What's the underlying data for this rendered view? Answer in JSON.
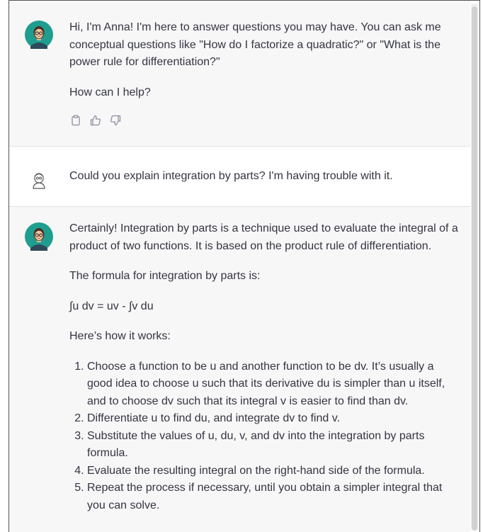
{
  "messages": [
    {
      "role": "assistant",
      "paragraphs": [
        "Hi, I'm Anna! I'm here to answer questions you may have. You can ask me conceptual questions like \"How do I factorize a quadratic?\" or \"What is the power rule for differentiation?\"",
        "How can I help?"
      ],
      "actions": [
        "copy-icon",
        "thumbs-up-icon",
        "thumbs-down-icon"
      ]
    },
    {
      "role": "user",
      "text": "Could you explain integration by parts? I'm having trouble with it."
    },
    {
      "role": "assistant",
      "paragraphs": [
        "Certainly! Integration by parts is a technique used to evaluate the integral of a product of two functions. It is based on the product rule of differentiation.",
        "The formula for integration by parts is:",
        "∫u dv = uv - ∫v du",
        "Here’s how it works:"
      ],
      "steps": [
        "Choose a function to be u and another function to be dv. It’s usually a good idea to choose u such that its derivative du is simpler than u itself, and to choose dv such that its integral v is easier to find than dv.",
        "Differentiate u to find du, and integrate dv to find v.",
        "Substitute the values of u, du, v, and dv into the integration by parts formula.",
        "Evaluate the resulting integral on the right-hand side of the formula.",
        "Repeat the process if necessary, until you obtain a simpler integral that you can solve."
      ]
    }
  ],
  "colors": {
    "assistant_bg": "#f7f7f8",
    "user_bg": "#ffffff",
    "avatar_teal": "#1f9e8f",
    "text": "#343541",
    "icon_gray": "#8e8ea0"
  }
}
